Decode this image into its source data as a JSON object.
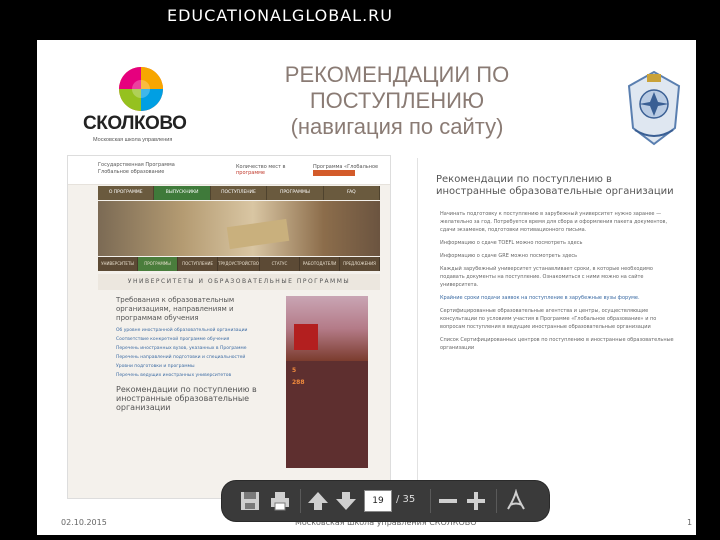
{
  "site_title": "EDUCATIONALGLOBAL.RU",
  "slide": {
    "logo_text": "СКОЛКОВО",
    "logo_sub": "Московская школа управления",
    "heading_line1": "РЕКОМЕНДАЦИИ ПО",
    "heading_line2": "ПОСТУПЛЕНИЮ",
    "heading_line3": "(навигация по сайту)",
    "footer_date": "02.10.2015",
    "footer_org": "Московская школа управления СКОЛКОВО",
    "footer_page": "1"
  },
  "thumbnail": {
    "top_left_1": "Государственная Программа",
    "top_left_2": "Глобальное образование",
    "top_mid_1": "Количество мест в",
    "top_mid_2": "программе",
    "top_right_1": "Программа «Глобальное",
    "nav": [
      "О ПРОГРАММЕ",
      "ВЫПУСКНИКИ",
      "ПОСТУПЛЕНИЕ",
      "ПРОГРАММЫ",
      "FAQ"
    ],
    "tabs": [
      "УНИВЕРСИТЕТЫ",
      "ПРОГРАММЫ",
      "ПОСТУПЛЕНИЕ",
      "ТРУДОУСТРОЙСТВО",
      "СТАТУС",
      "РАБОТОДАТЕЛИ",
      "ПРЕДЛОЖЕНИЯ"
    ],
    "section": "УНИВЕРСИТЕТЫ И ОБРАЗОВАТЕЛЬНЫЕ ПРОГРАММЫ",
    "left_heading": "Требования к образовательным организациям, направлениям и программам обучения",
    "left_links": [
      "Об уровне иностранной образовательной организации",
      "Соответствие конкретной программе обучения",
      "Перечень иностранных вузов, указанных в Программе",
      "Перечень направлений подготовки и специальностей",
      "Уровни подготовки и программы",
      "Перечень ведущих иностранных университетов"
    ],
    "left_heading2": "Рекомендации по поступлению в иностранные образовательные организации",
    "right_num1": "5",
    "right_num2": "288"
  },
  "doc": {
    "title": "Рекомендации по поступлению в иностранные образовательные организации",
    "paragraphs": [
      "Начинать подготовку к поступлению в зарубежный университет нужно заранее — желательно за год. Потребуется время для сбора и оформления пакета документов, сдачи экзаменов, подготовки мотивационного письма.",
      "Информацию о сдаче TOEFL можно посмотреть здесь",
      "Информацию о сдаче GRE можно посмотреть здесь",
      "Каждый зарубежный университет устанавливает сроки, в которые необходимо подавать документы на поступление. Ознакомиться с ними можно на сайте университета.",
      "Крайние сроки подачи заявок на поступление в зарубежные вузы форуме.",
      "Сертифицированные образовательные агентства и центры, осуществляющие консультации по условиям участия в Программе «Глобальное образование» и по вопросам поступления в ведущие иностранные образовательные организации",
      "Список Сертифицированных центров по поступлению в иностранные образовательные организации"
    ],
    "link_word": "здесь"
  },
  "toolbar": {
    "current_page": "19",
    "total_pages": "/ 35",
    "icons": [
      "save-icon",
      "print-icon",
      "page-up-icon",
      "page-down-icon",
      "zoom-out-icon",
      "zoom-in-icon",
      "acrobat-icon"
    ]
  }
}
